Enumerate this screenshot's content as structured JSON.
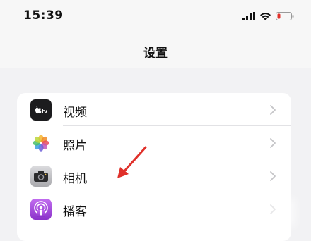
{
  "status_bar": {
    "time": "15:39",
    "icons": [
      "cellular-signal-icon",
      "wifi-icon",
      "battery-low-icon"
    ]
  },
  "nav": {
    "title": "设置"
  },
  "settings_list": [
    {
      "label": "视频",
      "icon": "apple-tv-icon"
    },
    {
      "label": "照片",
      "icon": "photos-icon"
    },
    {
      "label": "相机",
      "icon": "camera-icon"
    },
    {
      "label": "播客",
      "icon": "podcasts-icon"
    }
  ],
  "annotation": {
    "icon": "red-arrow-annotation",
    "color": "#e0302a"
  },
  "colors": {
    "battery_low": "#e0302a",
    "podcasts": "#9d4ed8",
    "chevron": "#c4c4c7"
  }
}
